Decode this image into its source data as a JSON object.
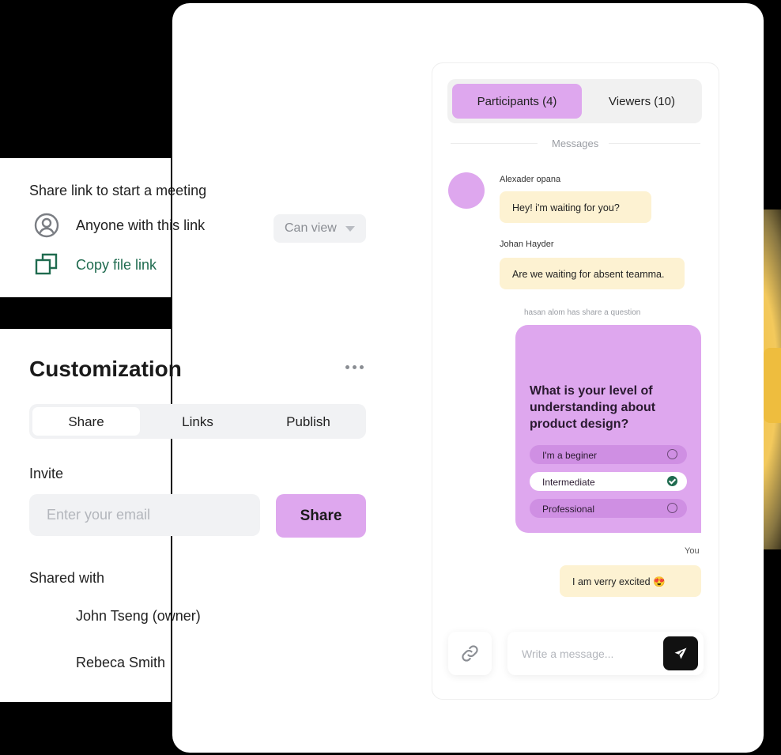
{
  "share": {
    "title": "Share link to start a meeting",
    "access_text": "Anyone with this link",
    "permission": "Can view",
    "copy_link": "Copy file link"
  },
  "customization": {
    "title": "Customization",
    "tabs": [
      {
        "label": "Share",
        "active": true
      },
      {
        "label": "Links",
        "active": false
      },
      {
        "label": "Publish",
        "active": false
      }
    ],
    "invite_label": "Invite",
    "email_placeholder": "Enter your email",
    "share_button": "Share",
    "shared_with_label": "Shared with",
    "shared_with": [
      "John Tseng (owner)",
      "Rebeca Smith"
    ]
  },
  "chat": {
    "tabs": [
      {
        "label": "Participants (4)",
        "active": true
      },
      {
        "label": "Viewers (10)",
        "active": false
      }
    ],
    "section_label": "Messages",
    "messages": [
      {
        "sender": "Alexader opana",
        "text": "Hey! i'm waiting for you?"
      },
      {
        "sender": "Johan Hayder",
        "text": "Are we waiting for absent teamma."
      }
    ],
    "system_note": "hasan alom has share a question",
    "question": {
      "text": "What is your level of understanding about product design?",
      "options": [
        {
          "label": "I'm a beginer",
          "selected": false
        },
        {
          "label": "Intermediate",
          "selected": true
        },
        {
          "label": "Professional",
          "selected": false
        }
      ]
    },
    "you_label": "You",
    "my_message": "I am verry excited 😍",
    "composer_placeholder": "Write a message..."
  },
  "colors": {
    "accent_purple": "#dea7ee",
    "bubble_yellow": "#fdf2d2",
    "link_green": "#1f6b4f",
    "blob_yellow": "#f2c24a"
  },
  "icons": [
    "user-circle-icon",
    "copy-icon",
    "caret-down-icon",
    "more-horizontal-icon",
    "link-icon",
    "send-icon",
    "check-icon"
  ]
}
